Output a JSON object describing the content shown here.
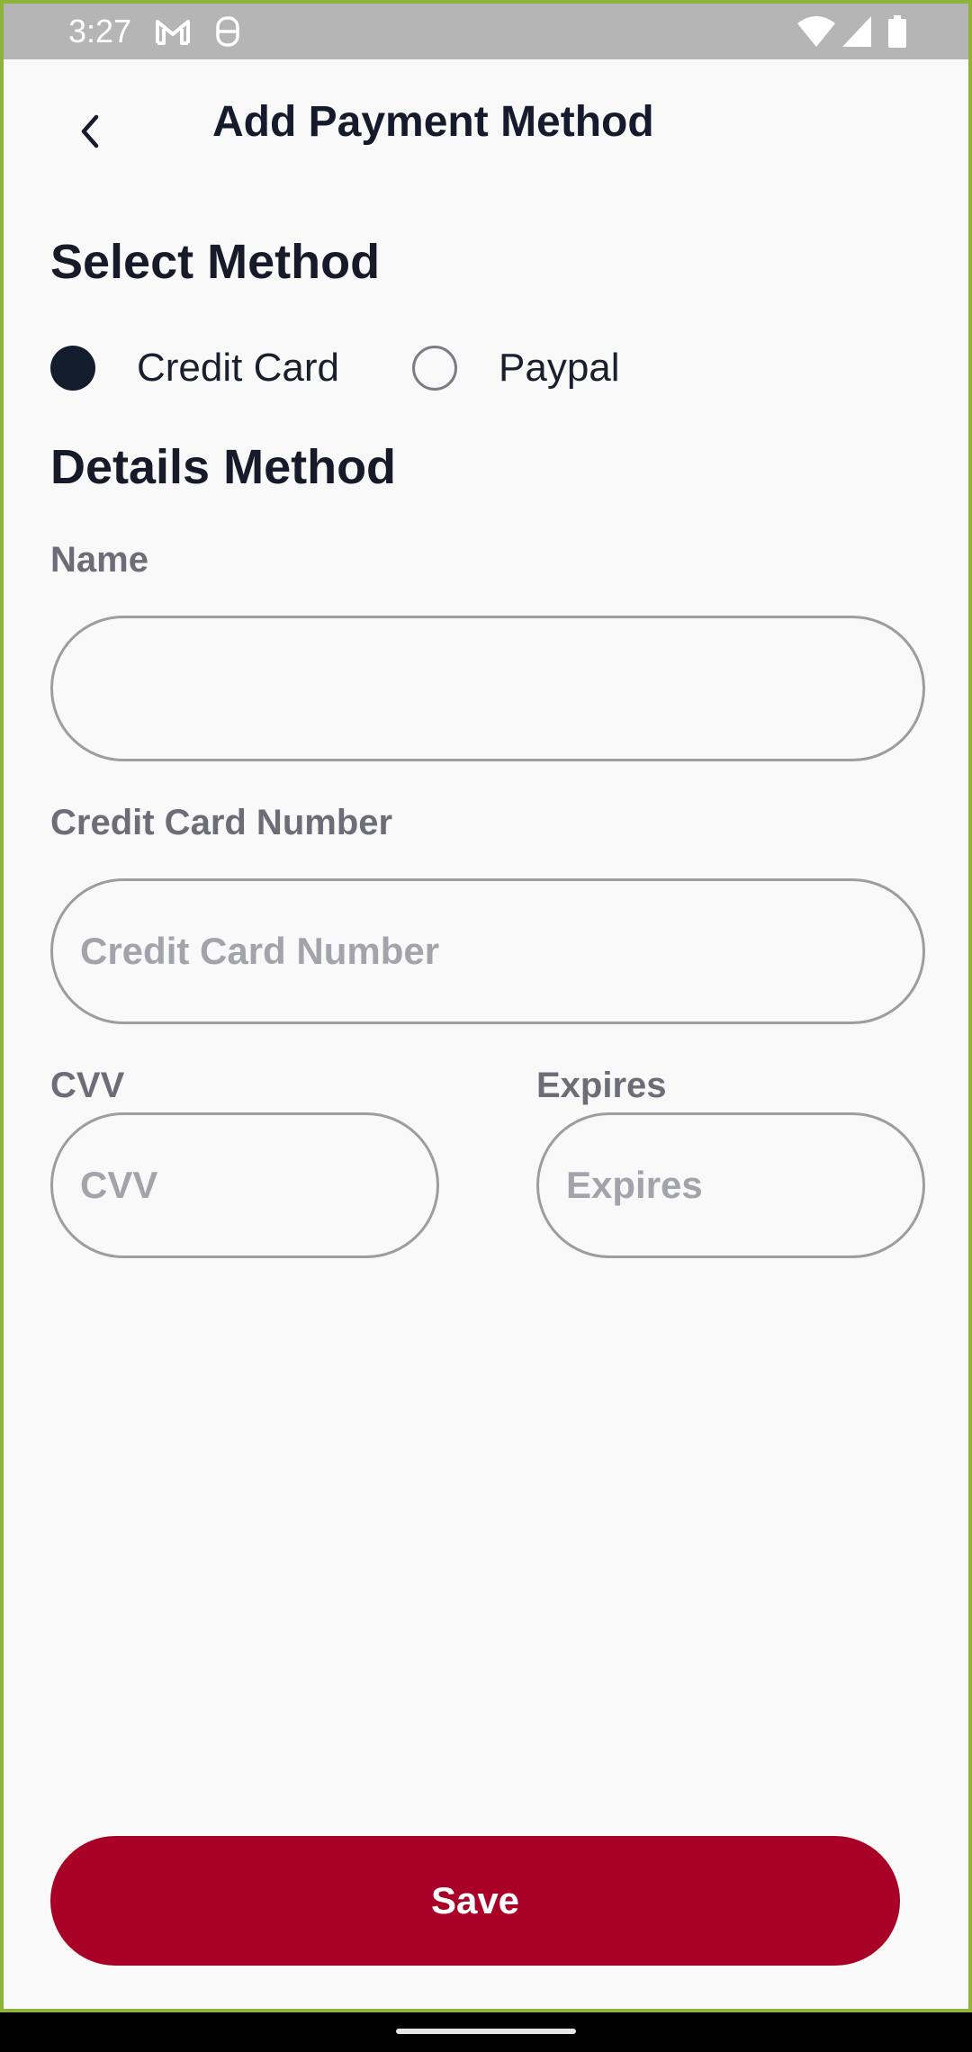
{
  "status_bar": {
    "time": "3:27",
    "notification_icons": [
      "gmail-icon",
      "notification-app-icon"
    ],
    "system_icons": [
      "wifi-icon",
      "signal-icon",
      "battery-icon"
    ]
  },
  "header": {
    "title": "Add Payment Method",
    "back_icon": "chevron-left-icon"
  },
  "select_method": {
    "title": "Select Method",
    "options": [
      {
        "label": "Credit Card",
        "selected": true
      },
      {
        "label": "Paypal",
        "selected": false
      }
    ]
  },
  "details": {
    "title": "Details Method",
    "name": {
      "label": "Name",
      "value": "",
      "placeholder": ""
    },
    "card_number": {
      "label": "Credit Card Number",
      "value": "",
      "placeholder": "Credit Card Number"
    },
    "cvv": {
      "label": "CVV",
      "value": "",
      "placeholder": "CVV"
    },
    "expires": {
      "label": "Expires",
      "value": "",
      "placeholder": "Expires"
    }
  },
  "save_button": {
    "label": "Save"
  },
  "colors": {
    "accent": "#a80026",
    "selected_radio": "#121c2c",
    "background": "#f9f9f9",
    "status_bar": "#b5b5b5"
  }
}
